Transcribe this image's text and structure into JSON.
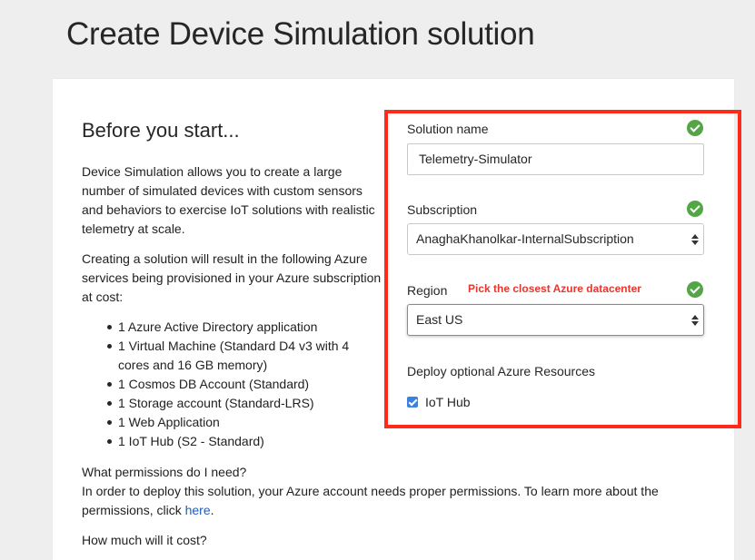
{
  "page": {
    "title": "Create Device Simulation solution"
  },
  "intro": {
    "heading": "Before you start...",
    "paragraph1": "Device Simulation allows you to create a large number of simulated devices with custom sensors and behaviors to exercise IoT solutions with realistic telemetry at scale.",
    "paragraph2": "Creating a solution will result in the following Azure services being provisioned in your Azure subscription at cost:",
    "services": [
      "1 Azure Active Directory application",
      "1 Virtual Machine (Standard D4 v3 with 4 cores and 16 GB memory)",
      "1 Cosmos DB Account (Standard)",
      "1 Storage account (Standard-LRS)",
      "1 Web Application",
      "1 IoT Hub (S2 - Standard)"
    ],
    "permissions_question": "What permissions do I need?",
    "permissions_answer_prefix": "In order to deploy this solution, your Azure account needs proper permissions. To learn more about the permissions, click ",
    "permissions_link": "here",
    "permissions_answer_suffix": ".",
    "cost_question": "How much will it cost?"
  },
  "form": {
    "solution_name": {
      "label": "Solution name",
      "value": "Telemetry-Simulator"
    },
    "subscription": {
      "label": "Subscription",
      "value": "AnaghaKhanolkar-InternalSubscription"
    },
    "region": {
      "label": "Region",
      "value": "East US",
      "hint": "Pick the closest Azure datacenter"
    },
    "optional": {
      "heading": "Deploy optional Azure Resources",
      "iot_hub_label": "IoT Hub",
      "iot_hub_checked": true
    }
  },
  "colors": {
    "highlight_border": "#ff2a17",
    "check_ok": "#53a546",
    "hint_text": "#e8362c",
    "link": "#1f5eb8",
    "checkbox": "#3b82e0"
  }
}
